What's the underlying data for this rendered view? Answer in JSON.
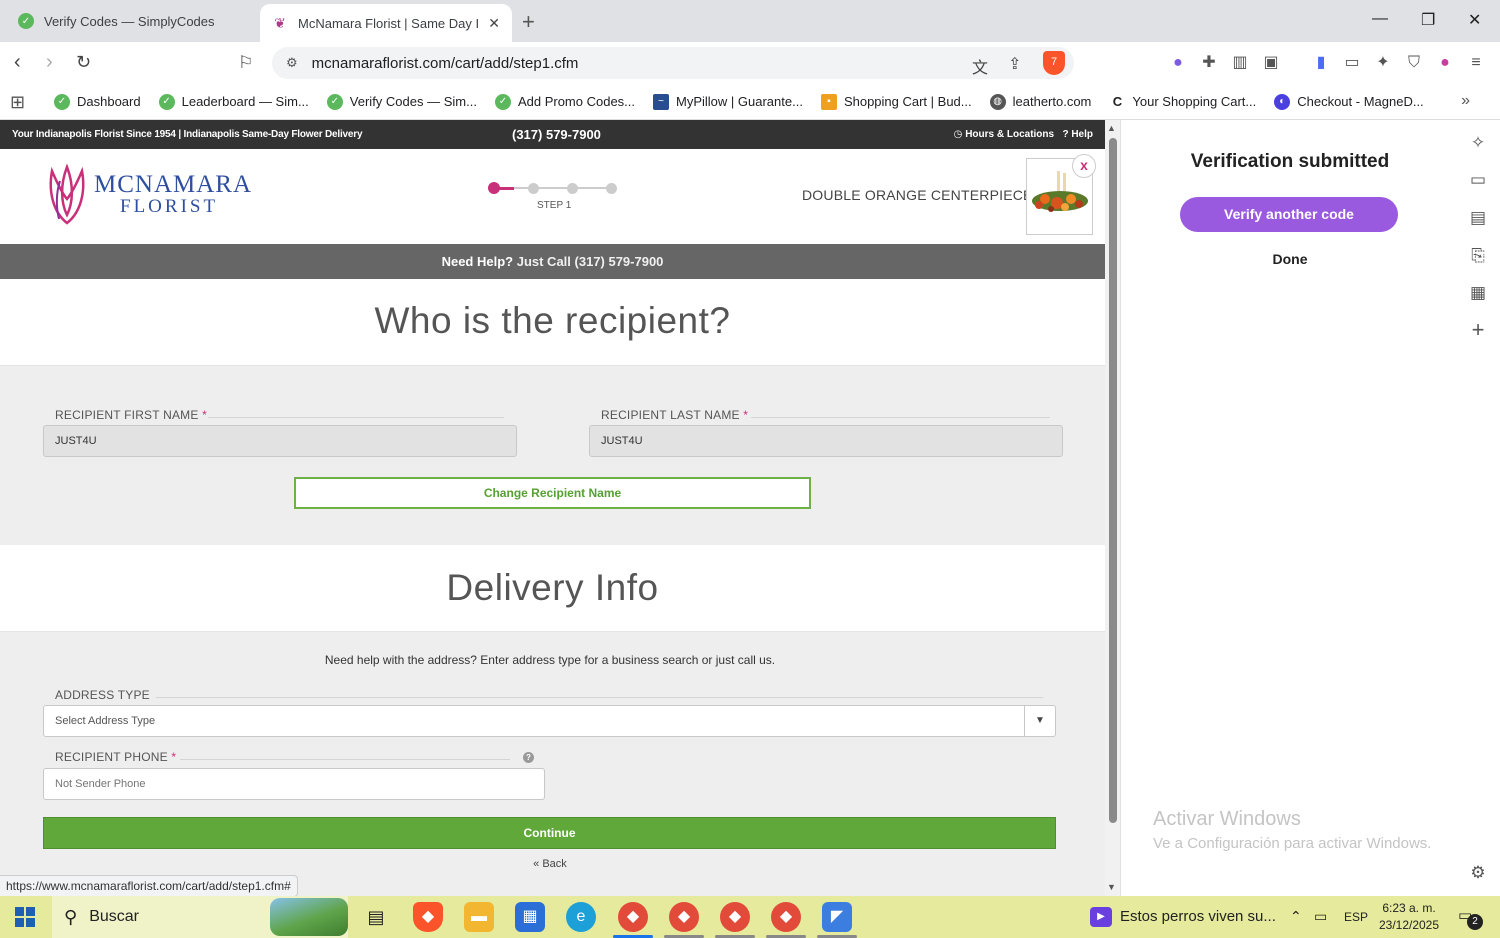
{
  "browser": {
    "tabs": [
      {
        "title": "Verify Codes — SimplyCodes",
        "active": false
      },
      {
        "title": "McNamara Florist | Same Day In",
        "active": true
      }
    ],
    "url": "mcnamaraflorist.com/cart/add/step1.cfm",
    "shield_count": "7",
    "bookmarks": [
      {
        "label": "Dashboard",
        "icon": "simplycodes-icon"
      },
      {
        "label": "Leaderboard — Sim...",
        "icon": "simplycodes-icon"
      },
      {
        "label": "Verify Codes — Sim...",
        "icon": "simplycodes-icon"
      },
      {
        "label": "Add Promo Codes...",
        "icon": "simplycodes-icon"
      },
      {
        "label": "MyPillow | Guarante...",
        "icon": "mypillow-icon"
      },
      {
        "label": "Shopping Cart | Bud...",
        "icon": "cart-icon"
      },
      {
        "label": "leatherto.com",
        "icon": "globe-icon"
      },
      {
        "label": "Your Shopping Cart...",
        "icon": "c-icon"
      },
      {
        "label": "Checkout - MagneD...",
        "icon": "magned-icon"
      }
    ],
    "status_url": "https://www.mcnamaraflorist.com/cart/add/step1.cfm#"
  },
  "site": {
    "topbar": {
      "tagline": "Your Indianapolis Florist Since 1954 | Indianapolis Same-Day Flower Delivery",
      "phone": "(317) 579-7900",
      "hours": "Hours & Locations",
      "help": "Help"
    },
    "logo": {
      "line1": "McNamara",
      "line2": "Florist"
    },
    "step_label": "STEP 1",
    "steps": {
      "current": 1,
      "total": 4
    },
    "product_name": "DOUBLE ORANGE CENTERPIECE",
    "close": "x",
    "helpbar": {
      "lead": "Need Help?",
      "call": "Just Call (317) 579-7900"
    },
    "recipient": {
      "title": "Who is the recipient?",
      "first_name_label": "RECIPIENT FIRST NAME",
      "first_name_value": "JUST4U",
      "last_name_label": "RECIPIENT LAST NAME",
      "last_name_value": "JUST4U",
      "required_mark": "*",
      "change_button": "Change Recipient Name"
    },
    "delivery": {
      "title": "Delivery Info",
      "help_note": "Need help with the address? Enter address type for a business search or just call us.",
      "address_type_label": "ADDRESS TYPE",
      "address_type_value": "Select Address Type",
      "phone_label": "RECIPIENT PHONE",
      "phone_placeholder": "Not Sender Phone",
      "info_icon": "?",
      "continue_button": "Continue",
      "back_link": "« Back"
    }
  },
  "sidepanel": {
    "title": "Verification submitted",
    "verify_button": "Verify another code",
    "done_button": "Done",
    "watermark_title": "Activar Windows",
    "watermark_text": "Ve a Configuración para activar Windows."
  },
  "taskbar": {
    "search": "Buscar",
    "news": "Estos perros viven su...",
    "lang": "ESP",
    "time": "6:23 a. m.",
    "date": "23/12/2025",
    "notifications": "2"
  },
  "colors": {
    "brand_pink": "#c9307a",
    "green": "#61a83b",
    "purple": "#9a5ae0"
  }
}
